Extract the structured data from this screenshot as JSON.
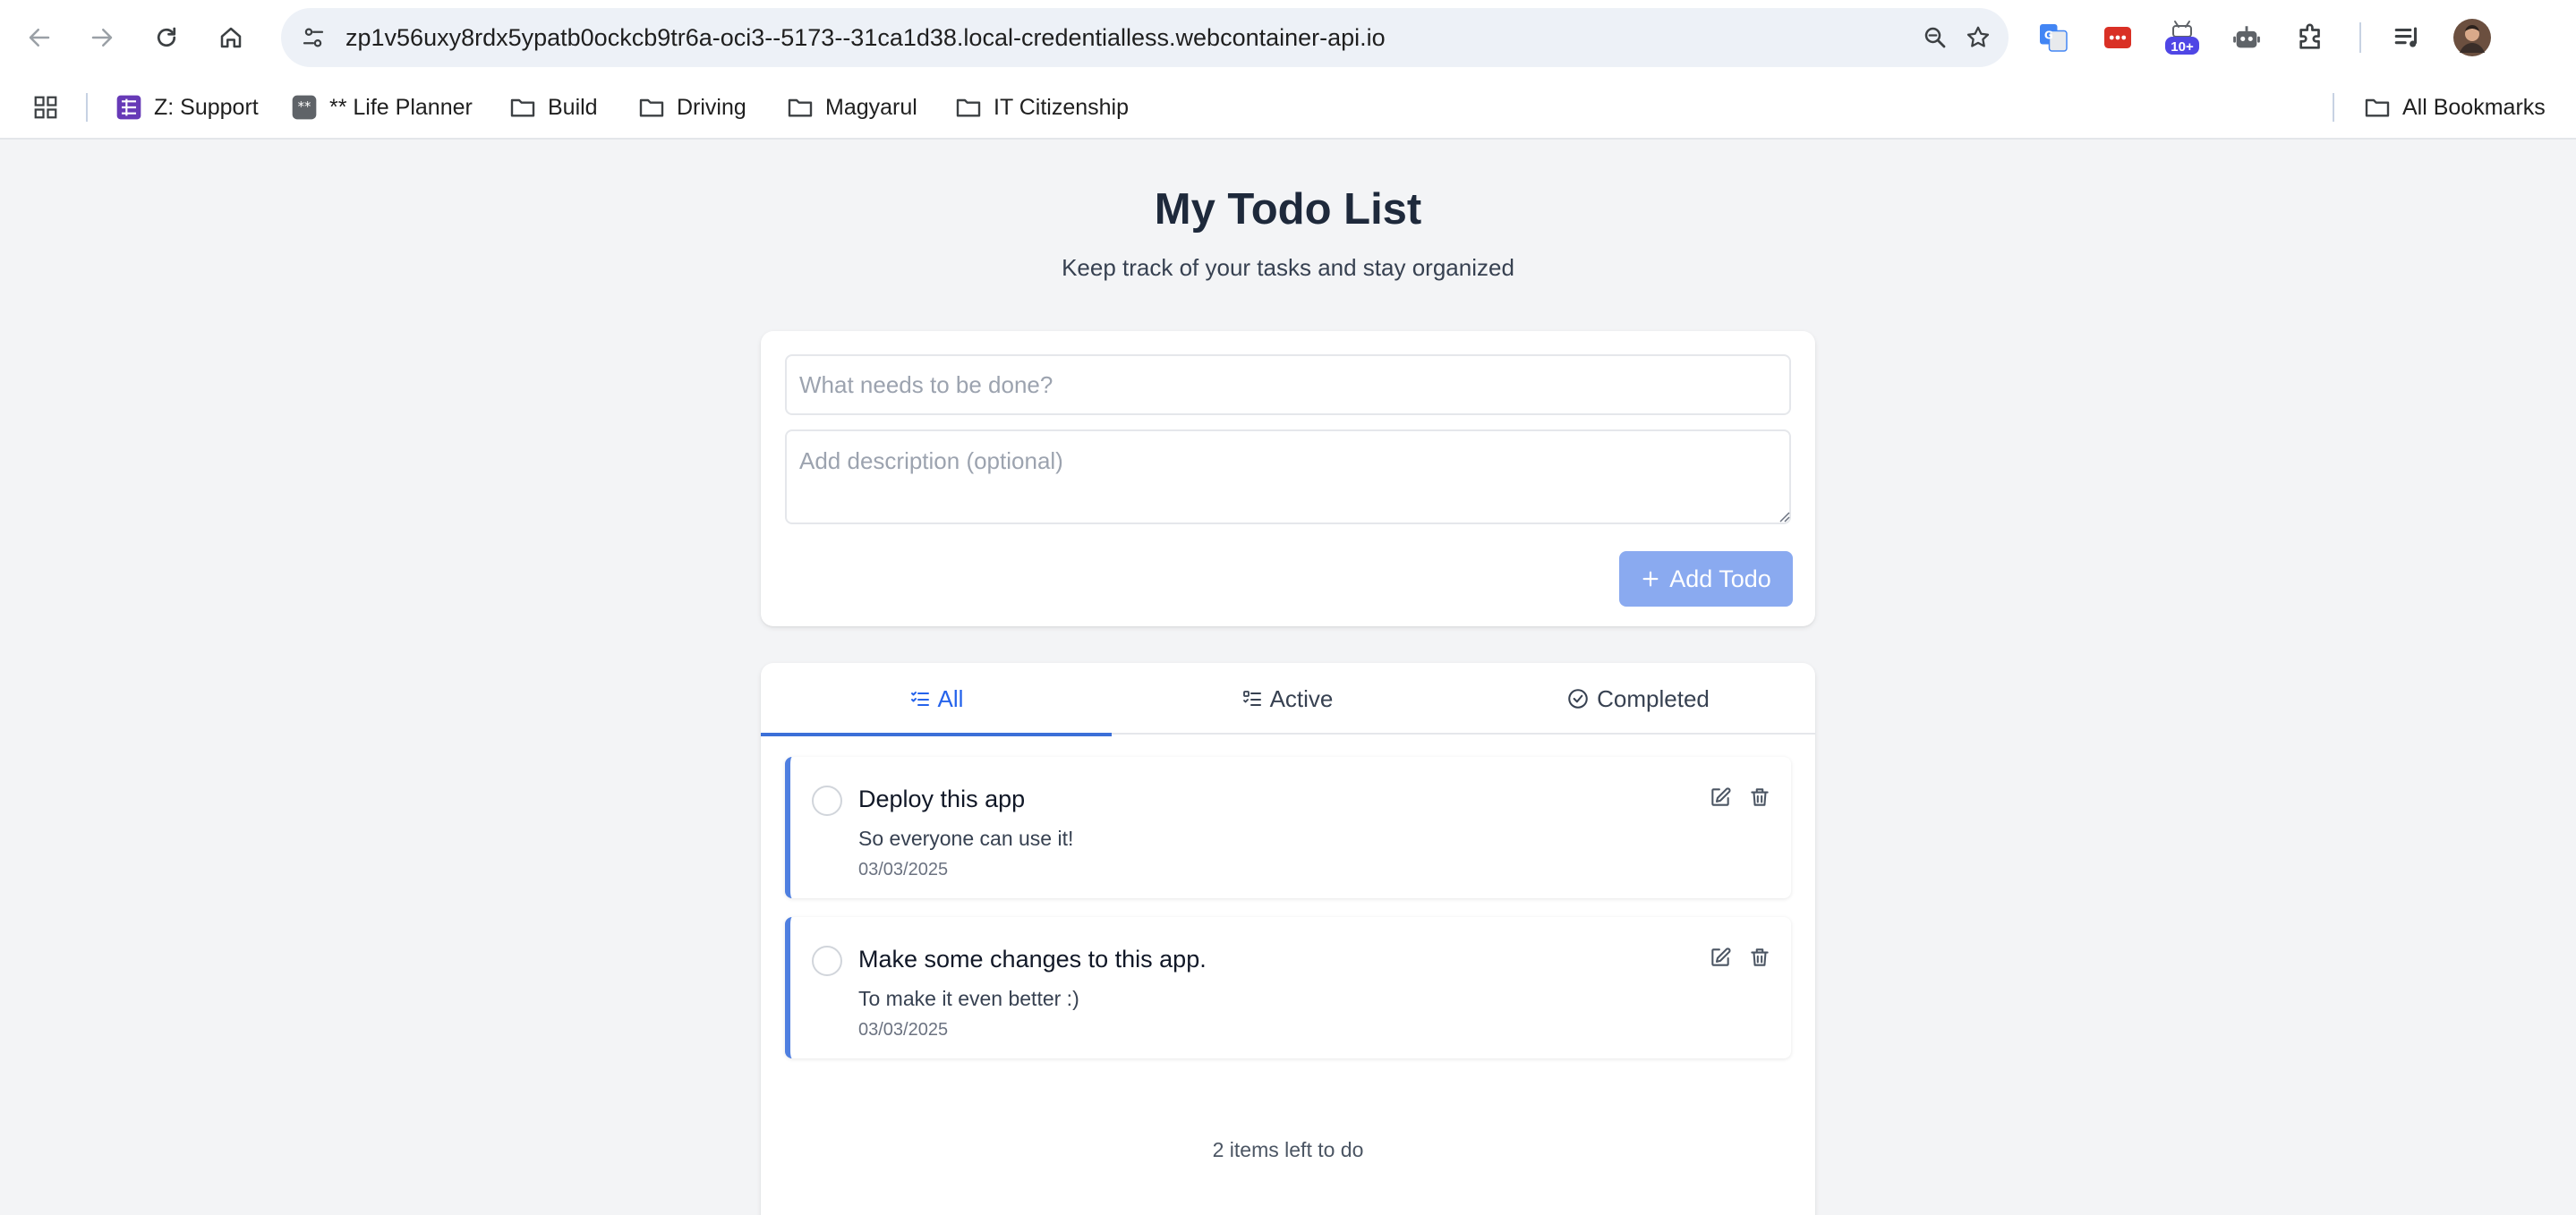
{
  "browser": {
    "url": "zp1v56uxy8rdx5ypatb0ockcb9tr6a-oci3--5173--31ca1d38.local-credentialless.webcontainer-api.io",
    "extension_badge": "10+",
    "bookmarks": [
      {
        "label": "Z: Support",
        "icon": "sheets-icon"
      },
      {
        "label": "** Life Planner",
        "icon": "app-icon"
      },
      {
        "label": "Build",
        "icon": "folder-icon"
      },
      {
        "label": "Driving",
        "icon": "folder-icon"
      },
      {
        "label": "Magyarul",
        "icon": "folder-icon"
      },
      {
        "label": "IT Citizenship",
        "icon": "folder-icon"
      }
    ],
    "all_bookmarks": "All Bookmarks"
  },
  "app": {
    "title": "My Todo List",
    "subtitle": "Keep track of your tasks and stay organized",
    "form": {
      "title_placeholder": "What needs to be done?",
      "description_placeholder": "Add description (optional)",
      "add_label": "Add Todo"
    },
    "tabs": [
      {
        "label": "All",
        "active": true
      },
      {
        "label": "Active",
        "active": false
      },
      {
        "label": "Completed",
        "active": false
      }
    ],
    "todos": [
      {
        "title": "Deploy this app",
        "description": "So everyone can use it!",
        "date": "03/03/2025"
      },
      {
        "title": "Make some changes to this app.",
        "description": "To make it even better :)",
        "date": "03/03/2025"
      }
    ],
    "footer": "2 items left to do"
  },
  "colors": {
    "accent": "#3b6fd8",
    "add_button": "#8aaaf0",
    "todo_border": "#4f7fe0",
    "page_bg": "#f3f4f6"
  }
}
